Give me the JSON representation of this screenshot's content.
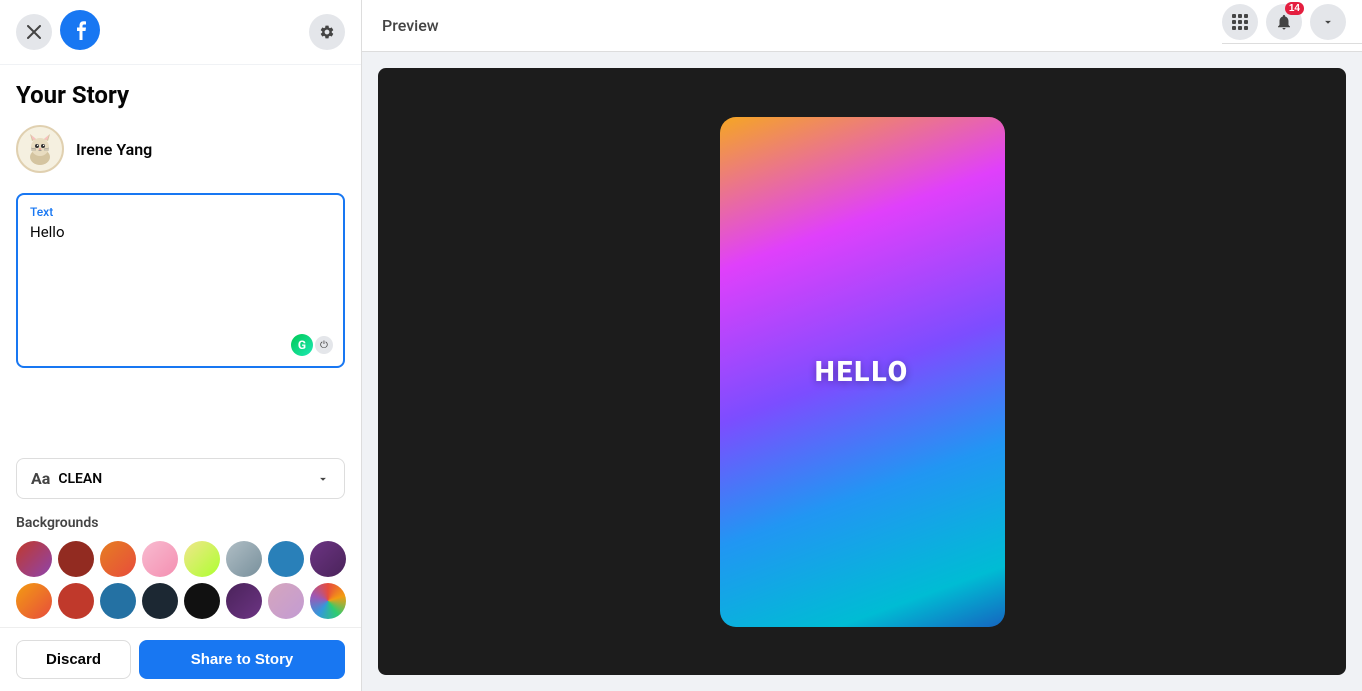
{
  "sidebar": {
    "title": "Your Story",
    "close_label": "✕",
    "gear_label": "⚙",
    "username": "Irene Yang",
    "text_field_label": "Text",
    "text_field_value": "Hello",
    "font_selector_aa": "Aa",
    "font_selector_name": "CLEAN",
    "backgrounds_label": "Backgrounds",
    "discard_label": "Discard",
    "share_label": "Share to Story"
  },
  "preview": {
    "label": "Preview",
    "story_text": "HELLO"
  },
  "nav": {
    "notification_count": "14"
  },
  "backgrounds": [
    {
      "id": "bg1",
      "colors": [
        "#c0392b",
        "#8e44ad"
      ],
      "type": "gradient"
    },
    {
      "id": "bg2",
      "colors": [
        "#922b21"
      ],
      "type": "solid"
    },
    {
      "id": "bg3",
      "colors": [
        "#e67e22",
        "#e74c3c"
      ],
      "type": "gradient"
    },
    {
      "id": "bg4",
      "colors": [
        "#f8bbd0",
        "#f48fb1"
      ],
      "type": "gradient"
    },
    {
      "id": "bg5",
      "colors": [
        "#f0e68c",
        "#adff2f"
      ],
      "type": "gradient"
    },
    {
      "id": "bg6",
      "colors": [
        "#95a5a6",
        "#7f8c8d"
      ],
      "type": "gradient"
    },
    {
      "id": "bg7",
      "colors": [
        "#2980b9",
        "#1a5276"
      ],
      "type": "gradient"
    },
    {
      "id": "bg8",
      "colors": [
        "#6c3483",
        "#4a235a"
      ],
      "type": "gradient"
    },
    {
      "id": "bg9",
      "colors": [
        "#f39c12",
        "#e74c3c"
      ],
      "type": "gradient"
    },
    {
      "id": "bg10",
      "colors": [
        "#c0392b",
        "#922b21"
      ],
      "type": "gradient"
    },
    {
      "id": "bg11",
      "colors": [
        "#2471a3",
        "#1a5276"
      ],
      "type": "gradient"
    },
    {
      "id": "bg12",
      "colors": [
        "#1c2833"
      ],
      "type": "solid"
    },
    {
      "id": "bg13",
      "colors": [
        "#212121"
      ],
      "type": "solid"
    },
    {
      "id": "bg14",
      "colors": [
        "#4a235a",
        "#6c3483"
      ],
      "type": "gradient"
    },
    {
      "id": "bg15",
      "colors": [
        "#d5a6bd",
        "#c39bd3"
      ],
      "type": "gradient"
    },
    {
      "id": "bg16",
      "colors": [
        "#e74c3c",
        "#c0392b"
      ],
      "type": "multicolor"
    }
  ]
}
